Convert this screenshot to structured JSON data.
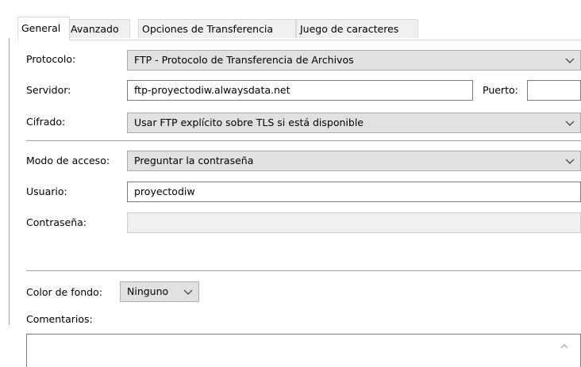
{
  "tabs": [
    {
      "label": "General"
    },
    {
      "label": "Avanzado"
    },
    {
      "label": "Opciones de Transferencia"
    },
    {
      "label": "Juego de caracteres"
    }
  ],
  "form": {
    "protocol": {
      "label": "Protocolo:",
      "value": "FTP - Protocolo de Transferencia de Archivos"
    },
    "server": {
      "label": "Servidor:",
      "value": "ftp-proyectodiw.alwaysdata.net"
    },
    "port": {
      "label": "Puerto:",
      "value": ""
    },
    "encryption": {
      "label": "Cifrado:",
      "value": "Usar FTP explícito sobre TLS si está disponible"
    },
    "access_mode": {
      "label": "Modo de acceso:",
      "value": "Preguntar la contraseña"
    },
    "user": {
      "label": "Usuario:",
      "value": "proyectodiw"
    },
    "password": {
      "label": "Contraseña:",
      "value": ""
    },
    "background_color": {
      "label": "Color de fondo:",
      "value": "Ninguno"
    },
    "comments": {
      "label": "Comentarios:",
      "value": ""
    }
  },
  "icons": {
    "dropdown": "chevron-down-icon",
    "scroll_up": "chevron-up-icon"
  },
  "colors": {
    "select_bg": "#e1e1e1",
    "disabled_bg": "#f0f0f0",
    "border": "#7a7a7a"
  }
}
